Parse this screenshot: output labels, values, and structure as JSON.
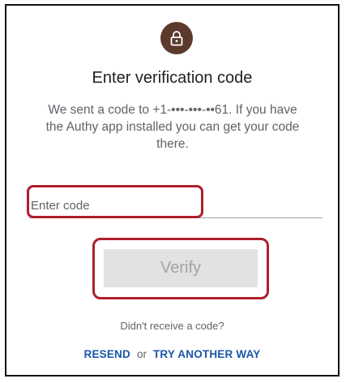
{
  "header": {
    "icon": "lock-icon",
    "badge_color": "#5b3a2d",
    "title": "Enter verification code"
  },
  "description": "We sent a code to +1-•••-•••-••61. If you have the Authy app installed you can get your code there.",
  "code_input": {
    "placeholder": "Enter code",
    "value": ""
  },
  "verify_button": {
    "label": "Verify",
    "enabled": false
  },
  "help": {
    "prompt": "Didn't receive a code?",
    "resend_label": "RESEND",
    "separator": "or",
    "alternative_label": "TRY ANOTHER WAY",
    "link_color": "#1a56a8"
  },
  "annotation_color": "#b01e2b"
}
